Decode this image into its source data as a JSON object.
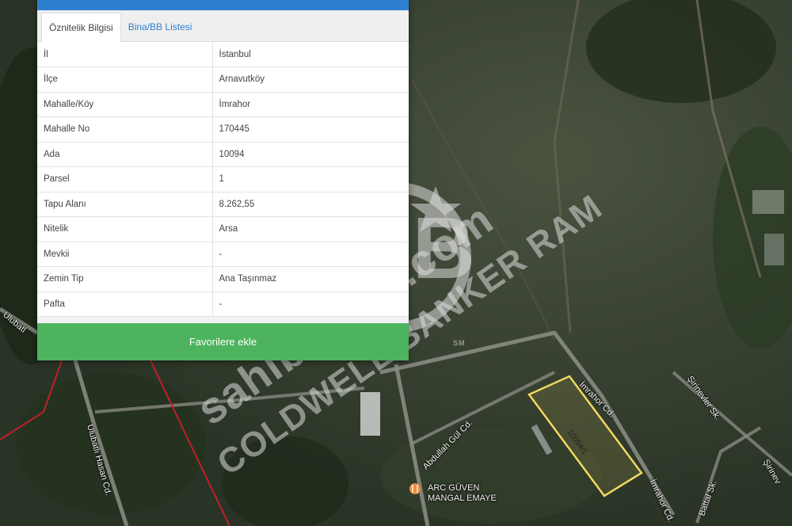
{
  "panel": {
    "tabs": [
      {
        "label": "Öznitelik Bilgisi"
      },
      {
        "label": "Bina/BB Listesi"
      }
    ],
    "rows": [
      {
        "key": "İl",
        "value": "İstanbul"
      },
      {
        "key": "İlçe",
        "value": "Arnavutköy"
      },
      {
        "key": "Mahalle/Köy",
        "value": "İmrahor"
      },
      {
        "key": "Mahalle No",
        "value": "170445"
      },
      {
        "key": "Ada",
        "value": "10094"
      },
      {
        "key": "Parsel",
        "value": "1"
      },
      {
        "key": "Tapu Alanı",
        "value": "8.262,55"
      },
      {
        "key": "Nitelik",
        "value": "Arsa"
      },
      {
        "key": "Mevkii",
        "value": "-"
      },
      {
        "key": "Zemin Tip",
        "value": "Ana Taşınmaz"
      },
      {
        "key": "Pafta",
        "value": "-"
      }
    ],
    "favorite_button": "Favorilere ekle"
  },
  "map": {
    "parcel_label": "10094/1",
    "streets": {
      "imrahor_cd_1": "İmrahor Cd.",
      "imrahor_cd_2": "İmrahor Cd.",
      "abdullah_gul": "Abdullah Gül Cd.",
      "ulubatli_hasan": "Ulubatlı Hasan Cd.",
      "ulubatli_left": "Ulubatl",
      "battal": "Battal Sk.",
      "sirinevler_1": "Şirinevler Sk.",
      "sirinevler_2": "Şirinev"
    },
    "poi": "ARC GÜVEN MANGAL EMAYE"
  },
  "watermark": {
    "site": "sahibinden.com",
    "agency": "COLDWELL BANKER RAM",
    "logo": "CB",
    "sm": "SM"
  },
  "colors": {
    "panel_topbar": "#2f7fd0",
    "tab_link": "#2f7fd0",
    "favorite_button": "#4db35e",
    "parcel_outline": "#f0d860",
    "boundary_line": "#c0202a"
  }
}
